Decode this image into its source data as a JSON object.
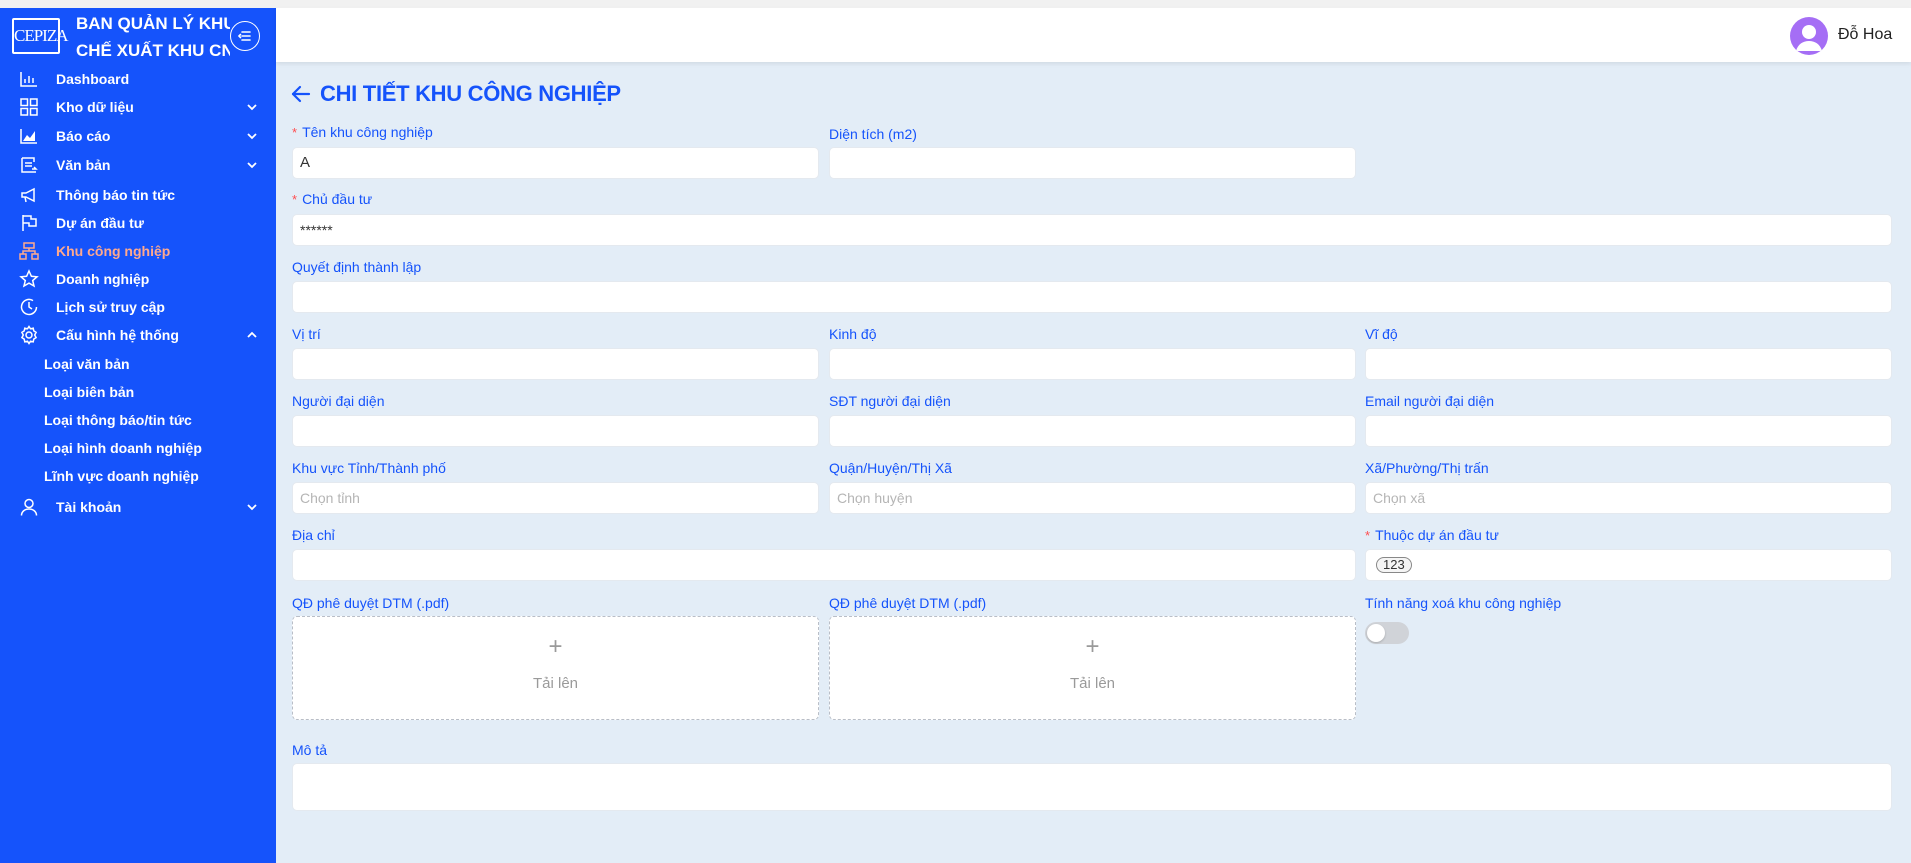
{
  "brand": {
    "logo_text": "CEPIZA",
    "title_line1": "BAN QUẢN LÝ KHU",
    "title_line2": "CHẾ XUẤT KHU CN"
  },
  "sidebar": {
    "items": [
      {
        "label": "Dashboard",
        "icon": "bar-chart-icon"
      },
      {
        "label": "Kho dữ liệu",
        "icon": "grid-icon",
        "expandable": true
      },
      {
        "label": "Báo cáo",
        "icon": "area-chart-icon",
        "expandable": true
      },
      {
        "label": "Văn bản",
        "icon": "document-icon",
        "expandable": true
      },
      {
        "label": "Thông báo tin tức",
        "icon": "megaphone-icon"
      },
      {
        "label": "Dự án đầu tư",
        "icon": "flag-icon"
      },
      {
        "label": "Khu công nghiệp",
        "icon": "cluster-icon",
        "active": true
      },
      {
        "label": "Doanh nghiệp",
        "icon": "star-icon"
      },
      {
        "label": "Lịch sử truy cập",
        "icon": "clock-icon"
      },
      {
        "label": "Cấu hình hệ thống",
        "icon": "gear-icon",
        "expanded": true
      },
      {
        "label": "Tài khoản",
        "icon": "user-icon",
        "expandable": true
      }
    ],
    "subitems": [
      {
        "label": "Loại văn bản"
      },
      {
        "label": "Loại biên bản"
      },
      {
        "label": "Loại thông báo/tin tức"
      },
      {
        "label": "Loại hình doanh nghiệp"
      },
      {
        "label": "Lĩnh vực doanh nghiệp"
      }
    ]
  },
  "header": {
    "username": "Đỗ Hoa"
  },
  "page": {
    "title": "CHI TIẾT KHU CÔNG NGHIỆP"
  },
  "form": {
    "ten_khu": {
      "label": "Tên khu công nghiệp",
      "value": "A",
      "required": true
    },
    "dien_tich": {
      "label": "Diện tích (m2)",
      "value": ""
    },
    "chu_dau_tu": {
      "label": "Chủ đầu tư",
      "value": "******",
      "required": true
    },
    "quyet_dinh": {
      "label": "Quyết định thành lập",
      "value": ""
    },
    "vi_tri": {
      "label": "Vị trí",
      "value": ""
    },
    "kinh_do": {
      "label": "Kinh độ",
      "value": ""
    },
    "vi_do": {
      "label": "Vĩ độ",
      "value": ""
    },
    "nguoi_dai_dien": {
      "label": "Người đại diện",
      "value": ""
    },
    "sdt": {
      "label": "SĐT người đại diện",
      "value": ""
    },
    "email": {
      "label": "Email người đại diện",
      "value": ""
    },
    "tinh": {
      "label": "Khu vực Tỉnh/Thành phố",
      "placeholder": "Chọn tỉnh"
    },
    "huyen": {
      "label": "Quận/Huyện/Thị Xã",
      "placeholder": "Chọn huyện"
    },
    "xa": {
      "label": "Xã/Phường/Thị trấn",
      "placeholder": "Chọn xã"
    },
    "dia_chi": {
      "label": "Địa chỉ",
      "value": ""
    },
    "du_an": {
      "label": "Thuộc dự án đầu tư",
      "tag": "123",
      "required": true
    },
    "qd_dtm_1": {
      "label": "QĐ phê duyệt DTM (.pdf)",
      "upload_text": "Tải lên"
    },
    "qd_dtm_2": {
      "label": "QĐ phê duyệt DTM (.pdf)",
      "upload_text": "Tải lên"
    },
    "xoa_khu": {
      "label": "Tính năng xoá khu công nghiệp",
      "enabled": false
    },
    "mo_ta": {
      "label": "Mô tả",
      "value": ""
    }
  },
  "colors": {
    "sidebar_bg": "#1553fb",
    "accent": "#1553fb",
    "active_menu": "#ffa98d",
    "page_bg": "#e3edf7",
    "required": "#ff4d4f"
  }
}
